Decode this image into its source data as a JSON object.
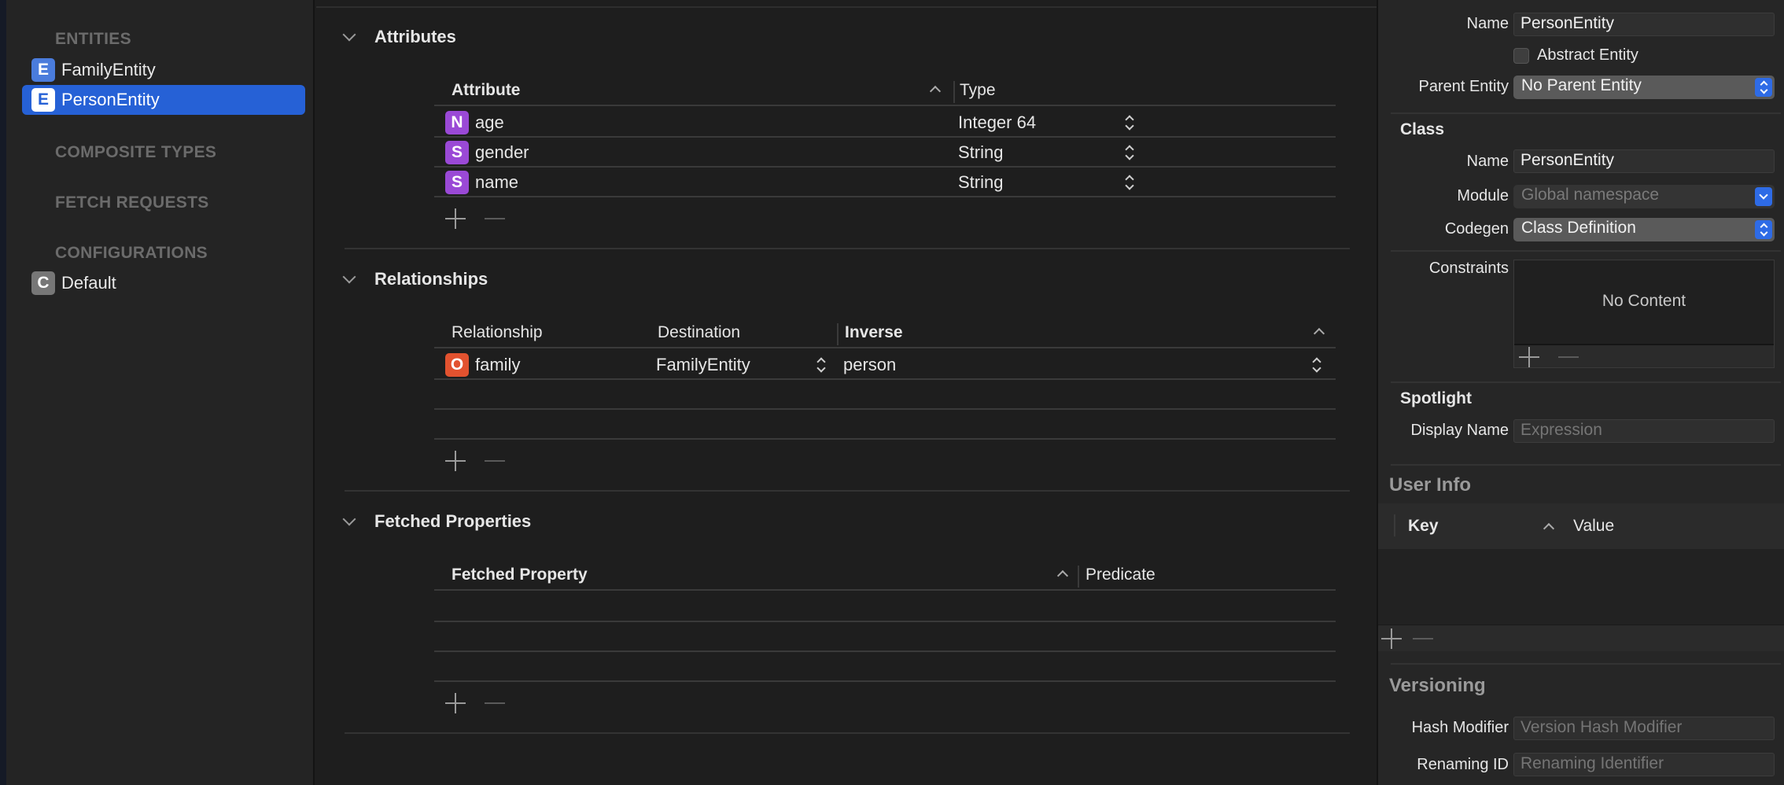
{
  "sidebar": {
    "entities_header": "ENTITIES",
    "entities": [
      {
        "badge": "E",
        "label": "FamilyEntity",
        "selected": false
      },
      {
        "badge": "E",
        "label": "PersonEntity",
        "selected": true
      }
    ],
    "composite_header": "COMPOSITE TYPES",
    "fetch_header": "FETCH REQUESTS",
    "config_header": "CONFIGURATIONS",
    "configurations": [
      {
        "badge": "C",
        "label": "Default"
      }
    ]
  },
  "attributes": {
    "title": "Attributes",
    "col_attribute": "Attribute",
    "col_type": "Type",
    "rows": [
      {
        "badge": "N",
        "name": "age",
        "type": "Integer 64"
      },
      {
        "badge": "S",
        "name": "gender",
        "type": "String"
      },
      {
        "badge": "S",
        "name": "name",
        "type": "String"
      }
    ]
  },
  "relationships": {
    "title": "Relationships",
    "col_relationship": "Relationship",
    "col_destination": "Destination",
    "col_inverse": "Inverse",
    "rows": [
      {
        "badge": "O",
        "name": "family",
        "destination": "FamilyEntity",
        "inverse": "person"
      }
    ]
  },
  "fetched": {
    "title": "Fetched Properties",
    "col_property": "Fetched Property",
    "col_predicate": "Predicate"
  },
  "inspector": {
    "name_label": "Name",
    "name_value": "PersonEntity",
    "abstract_label": "Abstract Entity",
    "parent_label": "Parent Entity",
    "parent_value": "No Parent Entity",
    "class_header": "Class",
    "class_name_label": "Name",
    "class_name_value": "PersonEntity",
    "module_label": "Module",
    "module_value": "Global namespace",
    "codegen_label": "Codegen",
    "codegen_value": "Class Definition",
    "constraints_label": "Constraints",
    "constraints_empty": "No Content",
    "spotlight_header": "Spotlight",
    "display_name_label": "Display Name",
    "display_name_placeholder": "Expression",
    "userinfo_header": "User Info",
    "userinfo_key": "Key",
    "userinfo_value": "Value",
    "versioning_header": "Versioning",
    "hash_label": "Hash Modifier",
    "hash_placeholder": "Version Hash Modifier",
    "renaming_label": "Renaming ID",
    "renaming_placeholder": "Renaming Identifier"
  },
  "colors": {
    "selection": "#2661d6",
    "badge_entity": "#4a7cdc",
    "badge_attribute": "#9a49d6",
    "badge_relationship": "#e2522f",
    "popup_accent": "#2e6be6"
  }
}
